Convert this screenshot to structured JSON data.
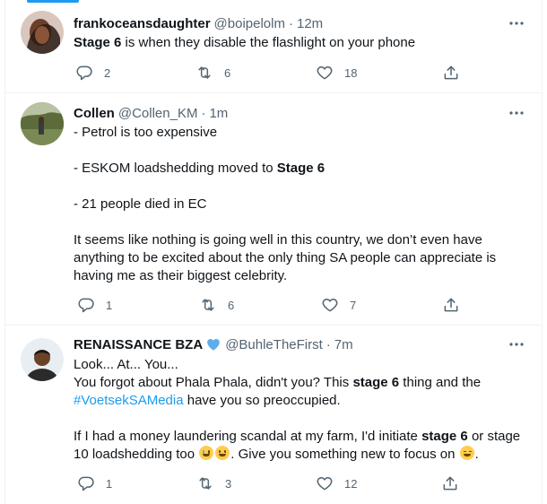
{
  "tweets": [
    {
      "name": "frankoceansdaughter",
      "handle": "@boipelolm",
      "separator": "·",
      "time": "12m",
      "lines": [
        [
          {
            "b": "Stage 6"
          },
          {
            "t": " is when they disable the flashlight on your phone"
          }
        ]
      ],
      "replies": "2",
      "retweets": "6",
      "likes": "18"
    },
    {
      "name": "Collen",
      "handle": "@Collen_KM",
      "separator": "·",
      "time": "1m",
      "lines": [
        [
          {
            "t": "- Petrol is too expensive"
          }
        ],
        [],
        [
          {
            "t": "- ESKOM loadshedding moved to "
          },
          {
            "b": "Stage 6"
          }
        ],
        [],
        [
          {
            "t": "- 21 people died in EC"
          }
        ],
        [],
        [
          {
            "t": "It seems like nothing is going well in this country, we don’t even have"
          }
        ],
        [
          {
            "t": "anything to be excited about the only thing SA people can appreciate is"
          }
        ],
        [
          {
            "t": "having me as their biggest celebrity."
          }
        ]
      ],
      "replies": "1",
      "retweets": "6",
      "likes": "7"
    },
    {
      "name": "RENAISSANCE BZA",
      "handle": "@BuhleTheFirst",
      "separator": "·",
      "time": "7m",
      "lines": [
        [
          {
            "t": "Look... At... You..."
          }
        ],
        [
          {
            "t": "You forgot about Phala Phala, didn't you? This "
          },
          {
            "b": "stage 6"
          },
          {
            "t": " thing and the"
          }
        ],
        [
          {
            "h": "#VoetsekSAMedia"
          },
          {
            "t": " have you so preoccupied."
          }
        ],
        [],
        [
          {
            "t": "If I had a money laundering scandal at my farm, I'd initiate "
          },
          {
            "b": "stage 6"
          },
          {
            "t": " or stage"
          }
        ],
        [
          {
            "t": "10 loadshedding too "
          },
          {
            "e": "joy"
          },
          {
            "e": "rofl"
          },
          {
            "t": ". Give you something new to focus on "
          },
          {
            "e": "wink"
          },
          {
            "t": "."
          }
        ]
      ],
      "replies": "1",
      "retweets": "3",
      "likes": "12"
    }
  ],
  "icons": {
    "reply": "reply-icon",
    "retweet": "retweet-icon",
    "like": "like-icon",
    "share": "share-icon",
    "more": "more-icon",
    "verified": "verified-badge-icon"
  },
  "colors": {
    "accent": "#1d9bf0",
    "text": "#0f1419",
    "secondary": "#536471",
    "border": "#eff3f4"
  }
}
